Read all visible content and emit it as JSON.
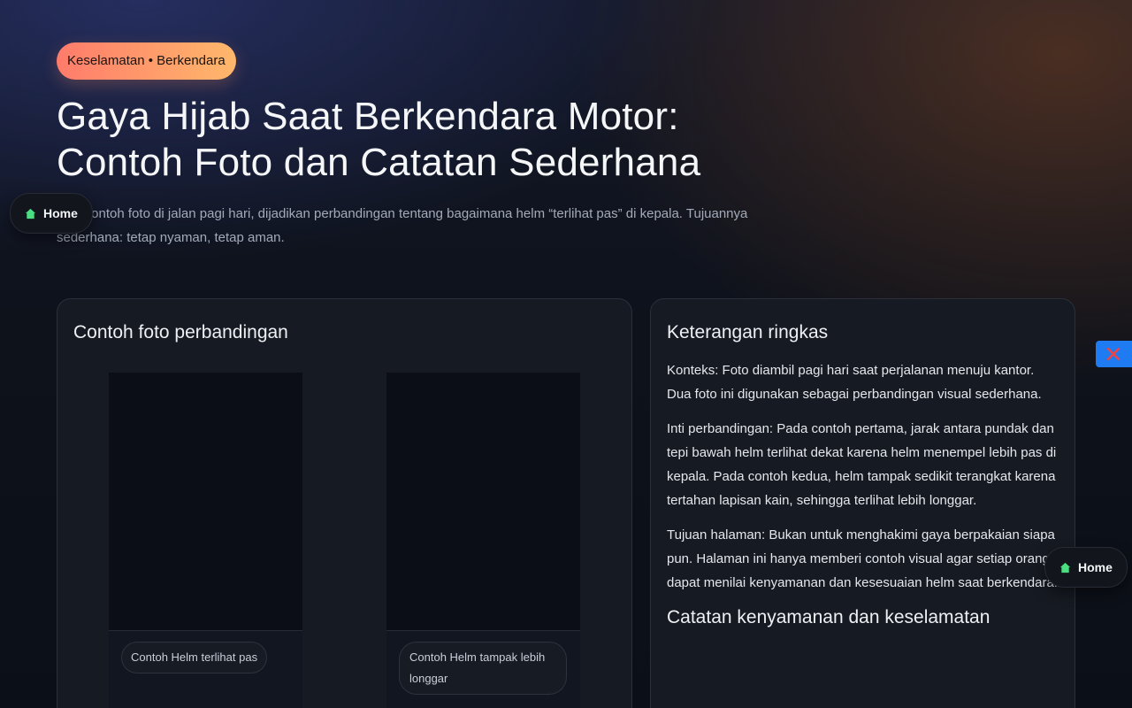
{
  "hero": {
    "tag": "Keselamatan • Berkendara",
    "title_line1": "Gaya Hijab Saat Berkendara Motor:",
    "title_line2": "Contoh Foto dan Catatan Sederhana",
    "lead": "Dua contoh foto di jalan pagi hari, dijadikan perbandingan tentang bagaimana helm “terlihat pas” di kepala. Tujuannya sederhana: tetap nyaman, tetap aman."
  },
  "floating": {
    "home_label": "Home",
    "home_icon": "home-icon",
    "close_icon": "close-icon",
    "home_icon_color": "#4ade80",
    "close_icon_color": "#ef4444",
    "close_bg": "#1f7bf2"
  },
  "photos_card": {
    "title": "Contoh foto perbandingan",
    "photos": [
      {
        "caption": "Contoh Helm terlihat pas"
      },
      {
        "caption": "Contoh Helm tampak lebih longgar"
      }
    ]
  },
  "notes_card": {
    "title": "Keterangan ringkas",
    "paragraphs": [
      "Konteks: Foto diambil pagi hari saat perjalanan menuju kantor. Dua foto ini digunakan sebagai perbandingan visual sederhana.",
      "Inti perbandingan: Pada contoh pertama, jarak antara pundak dan tepi bawah helm terlihat dekat karena helm menempel lebih pas di kepala. Pada contoh kedua, helm tampak sedikit terangkat karena tertahan lapisan kain, sehingga terlihat lebih longgar.",
      "Tujuan halaman: Bukan untuk menghakimi gaya berpakaian siapa pun. Halaman ini hanya memberi contoh visual agar setiap orang dapat menilai kenyamanan dan kesesuaian helm saat berkendara."
    ],
    "subheading": "Catatan kenyamanan dan keselamatan"
  },
  "colors": {
    "tag_gradient_start": "#ff7b6b",
    "tag_gradient_end": "#ffb86b",
    "card_bg": "#161a22"
  }
}
